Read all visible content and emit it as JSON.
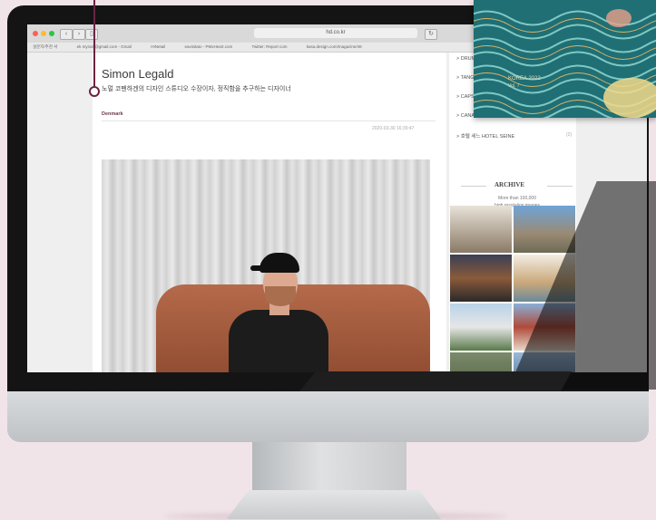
{
  "browser": {
    "url": "hd.co.kr",
    "bookmarks": [
      "설문지/추천 서",
      "ek myrain@gmail.com - Gmail",
      "HINetail",
      "eavisitato - PMxHeart.com",
      "Twitter: Report com",
      "kasa.design.com/magazine/48"
    ]
  },
  "article": {
    "title": "Simon Legald",
    "subtitle": "노멀 코펜하겐의 디자인 스튜디오 수장이자, 정직함을 추구하는 디자이너",
    "category": "Denmark",
    "date": "2020-03-30 16:39:47"
  },
  "sidebar": {
    "links": [
      {
        "label": "> DRUM",
        "count": ""
      },
      {
        "label": "> TANG",
        "count": ""
      },
      {
        "label": "> CAPS",
        "count": ""
      },
      {
        "label": "> CANA",
        "count": ""
      },
      {
        "label": "> 호텔 세느 HOTEL SEINE",
        "count": "(2)"
      }
    ],
    "archive_title": "ARCHIVE",
    "archive_line1": "More than 100,000",
    "archive_line2": "high resolution images"
  },
  "inset": {
    "caption_line1": "KOREA 2022",
    "caption_line2": "Vol. 7"
  },
  "colors": {
    "accent": "#6b2340",
    "background": "#f1e4e8"
  },
  "icons": [
    "close-dot-icon",
    "minimize-dot-icon",
    "maximize-dot-icon",
    "back-icon",
    "forward-icon",
    "sidebar-icon",
    "reload-icon"
  ]
}
